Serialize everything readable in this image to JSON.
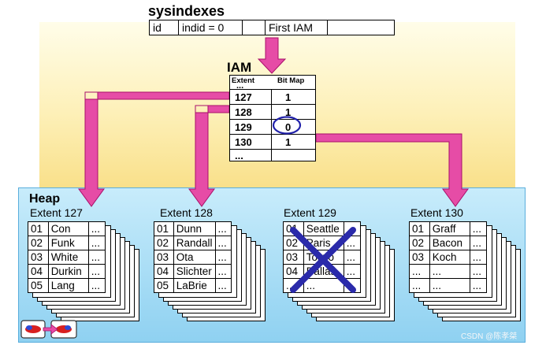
{
  "sysindexes": {
    "title": "sysindexes",
    "columns": [
      "id",
      "indid = 0",
      "",
      "First IAM",
      ""
    ]
  },
  "iam": {
    "title": "IAM",
    "header_extent": "Extent",
    "header_bitmap": "Bit Map",
    "header_ellipsis": "...",
    "rows": [
      {
        "extent": "127",
        "bit": "1"
      },
      {
        "extent": "128",
        "bit": "1"
      },
      {
        "extent": "129",
        "bit": "0"
      },
      {
        "extent": "130",
        "bit": "1"
      }
    ],
    "footer_ellipsis": "..."
  },
  "heap": {
    "title": "Heap",
    "extents": [
      {
        "label": "Extent 127",
        "rows": [
          [
            "01",
            "Con",
            "..."
          ],
          [
            "02",
            "Funk",
            "..."
          ],
          [
            "03",
            "White",
            "..."
          ],
          [
            "04",
            "Durkin",
            "..."
          ],
          [
            "05",
            "Lang",
            "..."
          ]
        ]
      },
      {
        "label": "Extent 128",
        "rows": [
          [
            "01",
            "Dunn",
            "..."
          ],
          [
            "02",
            "Randall",
            "..."
          ],
          [
            "03",
            "Ota",
            "..."
          ],
          [
            "04",
            "Slichter",
            "..."
          ],
          [
            "05",
            "LaBrie",
            "..."
          ]
        ]
      },
      {
        "label": "Extent 129",
        "rows": [
          [
            "01",
            "Seattle",
            "..."
          ],
          [
            "02",
            "Paris",
            "..."
          ],
          [
            "03",
            "Tokyo",
            "..."
          ],
          [
            "04",
            "Dallas",
            "..."
          ],
          [
            "...",
            "...",
            ""
          ]
        ]
      },
      {
        "label": "Extent 130",
        "rows": [
          [
            "01",
            "Graff",
            "..."
          ],
          [
            "02",
            "Bacon",
            "..."
          ],
          [
            "03",
            "Koch",
            "..."
          ],
          [
            "...",
            "...",
            "..."
          ],
          [
            "...",
            "...",
            "..."
          ]
        ]
      }
    ]
  },
  "watermark": "CSDN @陈孝桀",
  "colors": {
    "arrow": "#e64ca6",
    "arrow_stroke": "#a8106a",
    "cross": "#2a2aaa",
    "circle": "#2222aa"
  }
}
